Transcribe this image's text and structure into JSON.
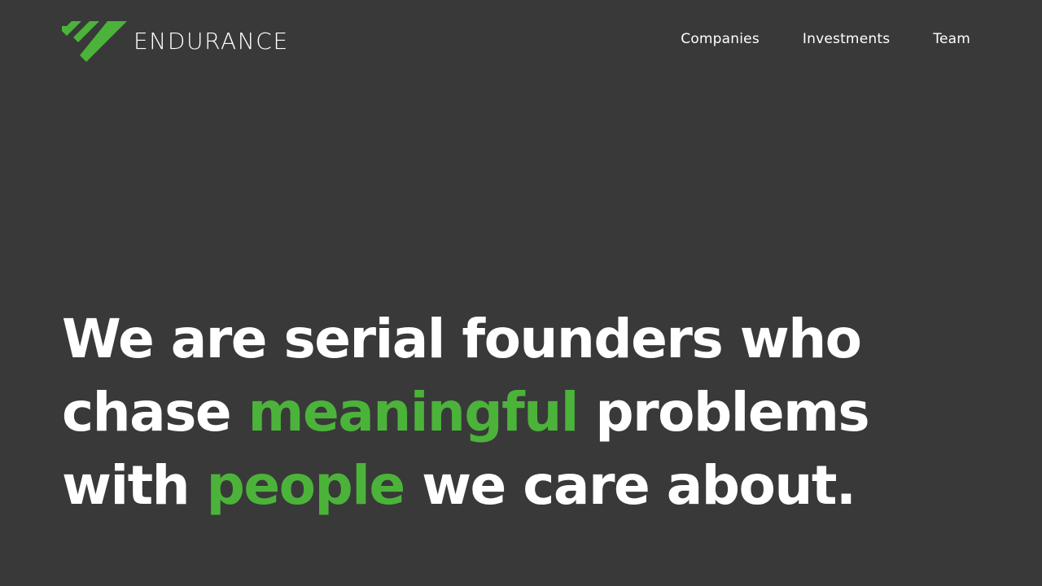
{
  "brand": {
    "name": "ENDURANCE",
    "accent_color": "#4cb33a",
    "background_color": "#393939",
    "logo_icon": "endurance-stripes-icon"
  },
  "nav": {
    "items": [
      {
        "label": "Companies"
      },
      {
        "label": "Investments"
      },
      {
        "label": "Team"
      }
    ]
  },
  "hero": {
    "line1": "We are serial founders who",
    "line2_before": "chase ",
    "line2_highlight": "meaningful",
    "line2_after": " problems",
    "line3_before": "with ",
    "line3_highlight": "people",
    "line3_after": " we care about."
  }
}
